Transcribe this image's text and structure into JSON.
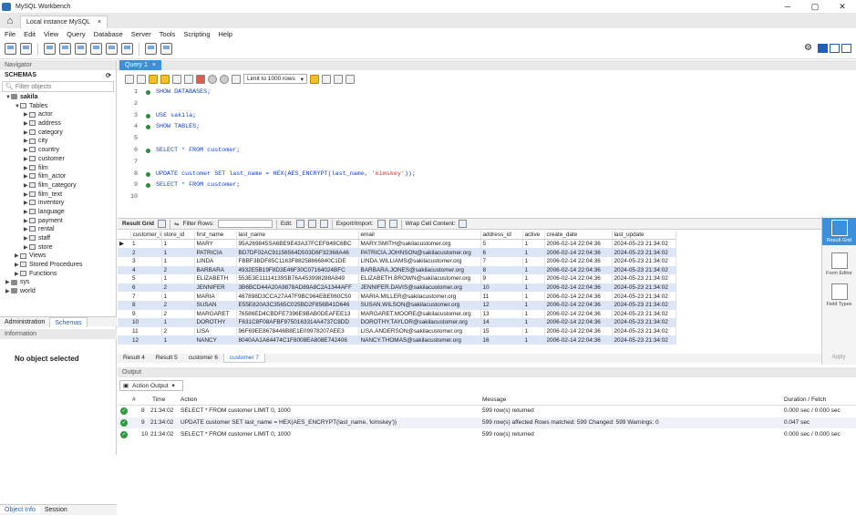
{
  "window": {
    "title": "MySQL Workbench",
    "controls": [
      "─",
      "▢",
      "✕"
    ]
  },
  "connection_tab": {
    "label": "Local instance MySQL",
    "close": "×"
  },
  "menu": [
    "File",
    "Edit",
    "View",
    "Query",
    "Database",
    "Server",
    "Tools",
    "Scripting",
    "Help"
  ],
  "navigator": {
    "header": "Navigator",
    "schemas_label": "SCHEMAS",
    "filter_placeholder": "Filter objects",
    "tree": [
      {
        "label": "sakila",
        "level": 0,
        "kind": "db",
        "open": true
      },
      {
        "label": "Tables",
        "level": 1,
        "kind": "folder",
        "open": true
      },
      {
        "label": "actor",
        "level": 2,
        "kind": "table"
      },
      {
        "label": "address",
        "level": 2,
        "kind": "table"
      },
      {
        "label": "category",
        "level": 2,
        "kind": "table"
      },
      {
        "label": "city",
        "level": 2,
        "kind": "table"
      },
      {
        "label": "country",
        "level": 2,
        "kind": "table"
      },
      {
        "label": "customer",
        "level": 2,
        "kind": "table"
      },
      {
        "label": "film",
        "level": 2,
        "kind": "table"
      },
      {
        "label": "film_actor",
        "level": 2,
        "kind": "table"
      },
      {
        "label": "film_category",
        "level": 2,
        "kind": "table"
      },
      {
        "label": "film_text",
        "level": 2,
        "kind": "table"
      },
      {
        "label": "inventory",
        "level": 2,
        "kind": "table"
      },
      {
        "label": "language",
        "level": 2,
        "kind": "table"
      },
      {
        "label": "payment",
        "level": 2,
        "kind": "table"
      },
      {
        "label": "rental",
        "level": 2,
        "kind": "table"
      },
      {
        "label": "staff",
        "level": 2,
        "kind": "table"
      },
      {
        "label": "store",
        "level": 2,
        "kind": "table"
      },
      {
        "label": "Views",
        "level": 1,
        "kind": "folder"
      },
      {
        "label": "Stored Procedures",
        "level": 1,
        "kind": "folder"
      },
      {
        "label": "Functions",
        "level": 1,
        "kind": "folder"
      },
      {
        "label": "sys",
        "level": 0,
        "kind": "db"
      },
      {
        "label": "world",
        "level": 0,
        "kind": "db"
      }
    ],
    "tabs": {
      "administration": "Administration",
      "schemas": "Schemas"
    },
    "information_header": "Information",
    "no_object": "No object selected",
    "bottom_tabs": {
      "object_info": "Object Info",
      "session": "Session"
    }
  },
  "query_tab": {
    "label": "Query 1",
    "close": "×"
  },
  "editor_toolbar": {
    "limit": "Limit to 1000 rows"
  },
  "editor_lines": [
    {
      "n": "1",
      "code": "SHOW DATABASES;",
      "dot": true
    },
    {
      "n": "2",
      "code": "",
      "dot": false
    },
    {
      "n": "3",
      "code": "USE sakila;",
      "dot": true
    },
    {
      "n": "4",
      "code": "SHOW TABLES;",
      "dot": true
    },
    {
      "n": "5",
      "code": "",
      "dot": false
    },
    {
      "n": "6",
      "code": "SELECT * FROM customer;",
      "dot": true
    },
    {
      "n": "7",
      "code": "",
      "dot": false
    },
    {
      "n": "8",
      "code": "UPDATE customer SET last_name = HEX(AES_ENCRYPT(last_name, 'kimskey'));",
      "dot": true
    },
    {
      "n": "9",
      "code": "SELECT * FROM customer;",
      "dot": true
    },
    {
      "n": "10",
      "code": "",
      "dot": false
    }
  ],
  "result_toolbar": {
    "result_grid": "Result Grid",
    "filter_rows": "Filter Rows:",
    "edit": "Edit:",
    "export_import": "Export/Import:",
    "wrap": "Wrap Cell Content:"
  },
  "grid": {
    "columns": [
      "customer_id",
      "store_id",
      "first_name",
      "last_name",
      "email",
      "address_id",
      "active",
      "create_date",
      "last_update"
    ],
    "rows": [
      [
        "1",
        "1",
        "MARY",
        "95A269845SA6BE9E43A37FCEF849C6BC",
        "MARY.SMITH@sakilacustomer.org",
        "5",
        "1",
        "2006-02-14 22:04:36",
        "2024-05-23 21:34:02"
      ],
      [
        "2",
        "1",
        "PATRICIA",
        "BD7DF02AC91156564D503D6F32368A46",
        "PATRICIA.JOHNSON@sakilacustomer.org",
        "6",
        "1",
        "2006-02-14 22:04:36",
        "2024-05-23 21:34:02"
      ],
      [
        "3",
        "1",
        "LINDA",
        "FBBF3BDF85C1163F88258866840C1DE",
        "LINDA.WILLIAMS@sakilacustomer.org",
        "7",
        "1",
        "2006-02-14 22:04:36",
        "2024-05-23 21:34:02"
      ],
      [
        "4",
        "2",
        "BARBARA",
        "4932E5B19F8D3E46F30C07164024BFC",
        "BARBARA.JONES@sakilacustomer.org",
        "8",
        "1",
        "2006-02-14 22:04:36",
        "2024-05-23 21:34:02"
      ],
      [
        "5",
        "1",
        "ELIZABETH",
        "553E3E11114139SB76A453998288A849",
        "ELIZABETH.BROWN@sakilacustomer.org",
        "9",
        "1",
        "2006-02-14 22:04:36",
        "2024-05-23 21:34:02"
      ],
      [
        "6",
        "2",
        "JENNIFER",
        "3B6BCD44A20A9878AD89A8C2A1344AFF",
        "JENNIFER.DAVIS@sakilacustomer.org",
        "10",
        "1",
        "2006-02-14 22:04:36",
        "2024-05-23 21:34:02"
      ],
      [
        "7",
        "1",
        "MARIA",
        "467898D3CCA27A47F9BC964EBE060C50",
        "MARIA.MILLER@sakilacustomer.org",
        "11",
        "1",
        "2006-02-14 22:04:36",
        "2024-05-23 21:34:02"
      ],
      [
        "8",
        "2",
        "SUSAN",
        "E55E820A3C3565C025BD2F856B41D646",
        "SUSAN.WILSON@sakilacustomer.org",
        "12",
        "1",
        "2006-02-14 22:04:36",
        "2024-05-23 21:34:02"
      ],
      [
        "9",
        "2",
        "MARGARET",
        "76586ED4CBDFE7396E9BAB0DEAFEE13",
        "MARGARET.MOORE@sakilacustomer.org",
        "13",
        "1",
        "2006-02-14 22:04:36",
        "2024-05-23 21:34:02"
      ],
      [
        "10",
        "1",
        "DOROTHY",
        "F631C8F08AFBF9750163314A4737C8DD",
        "DOROTHY.TAYLOR@sakilacustomer.org",
        "14",
        "1",
        "2006-02-14 22:04:36",
        "2024-05-23 21:34:02"
      ],
      [
        "11",
        "2",
        "LISA",
        "96F69EE8678446B8E1E09978207AEE3",
        "LISA.ANDERSON@sakilacustomer.org",
        "15",
        "1",
        "2006-02-14 22:04:36",
        "2024-05-23 21:34:02"
      ],
      [
        "12",
        "1",
        "NANCY",
        "8040AA1A64474C1F8008EA808E742406",
        "NANCY.THOMAS@sakilacustomer.org",
        "16",
        "1",
        "2006-02-14 22:04:36",
        "2024-05-23 21:34:02"
      ]
    ]
  },
  "result_tabs": [
    "Result 4",
    "Result 5",
    "customer 6",
    "customer 7"
  ],
  "right_panel": {
    "result_grid": "Result Grid",
    "form_editor": "Form Editor",
    "field_types": "Field Types",
    "apply": "Apply"
  },
  "output": {
    "header": "Output",
    "selector": "Action Output",
    "columns": {
      "num": "#",
      "time": "Time",
      "action": "Action",
      "message": "Message",
      "duration": "Duration / Fetch"
    },
    "rows": [
      {
        "num": "8",
        "time": "21:34:02",
        "action": "SELECT * FROM customer LIMIT 0, 1000",
        "message": "599 row(s) returned",
        "duration": "0.000 sec / 0.000 sec"
      },
      {
        "num": "9",
        "time": "21:34:02",
        "action": "UPDATE customer SET last_name = HEX(AES_ENCRYPT(last_name, 'kimskey'))",
        "message": "599 row(s) affected Rows matched: 599  Changed: 599  Warnings: 0",
        "duration": "0.047 sec"
      },
      {
        "num": "10",
        "time": "21:34:02",
        "action": "SELECT * FROM customer LIMIT 0, 1000",
        "message": "599 row(s) returned",
        "duration": "0.000 sec / 0.000 sec"
      }
    ]
  },
  "colors": {
    "accent": "#3c8fd9",
    "success": "#2e9a3d",
    "keyword": "#1a40c8",
    "string": "#c8302a"
  }
}
